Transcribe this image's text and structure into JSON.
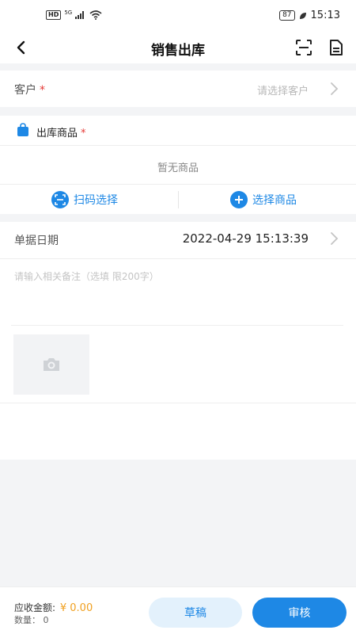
{
  "status_bar": {
    "network_badge": "HD",
    "network_type": "5G",
    "battery": "87",
    "time": "15:13"
  },
  "header": {
    "title": "销售出库",
    "back_icon": "chevron-left-icon",
    "scan_icon": "scan-frame-icon",
    "doc_icon": "document-icon"
  },
  "customer": {
    "label": "客户",
    "required_mark": "*",
    "placeholder": "请选择客户"
  },
  "goods": {
    "title": "出库商品",
    "required_mark": "*",
    "empty_text": "暂无商品",
    "scan_select_label": "扫码选择",
    "choose_goods_label": "选择商品"
  },
  "document": {
    "date_label": "单据日期",
    "date_value": "2022-04-29 15:13:39",
    "remark_placeholder": "请输入相关备注（选填 限200字）"
  },
  "footer": {
    "amount_label": "应收金额:",
    "amount_value": "¥ 0.00",
    "quantity_label": "数量：",
    "quantity_value": "0",
    "draft_label": "草稿",
    "audit_label": "审核"
  },
  "colors": {
    "accent": "#1e88e5",
    "required": "#e53935",
    "amount": "#f0a020",
    "background": "#f3f4f6"
  }
}
